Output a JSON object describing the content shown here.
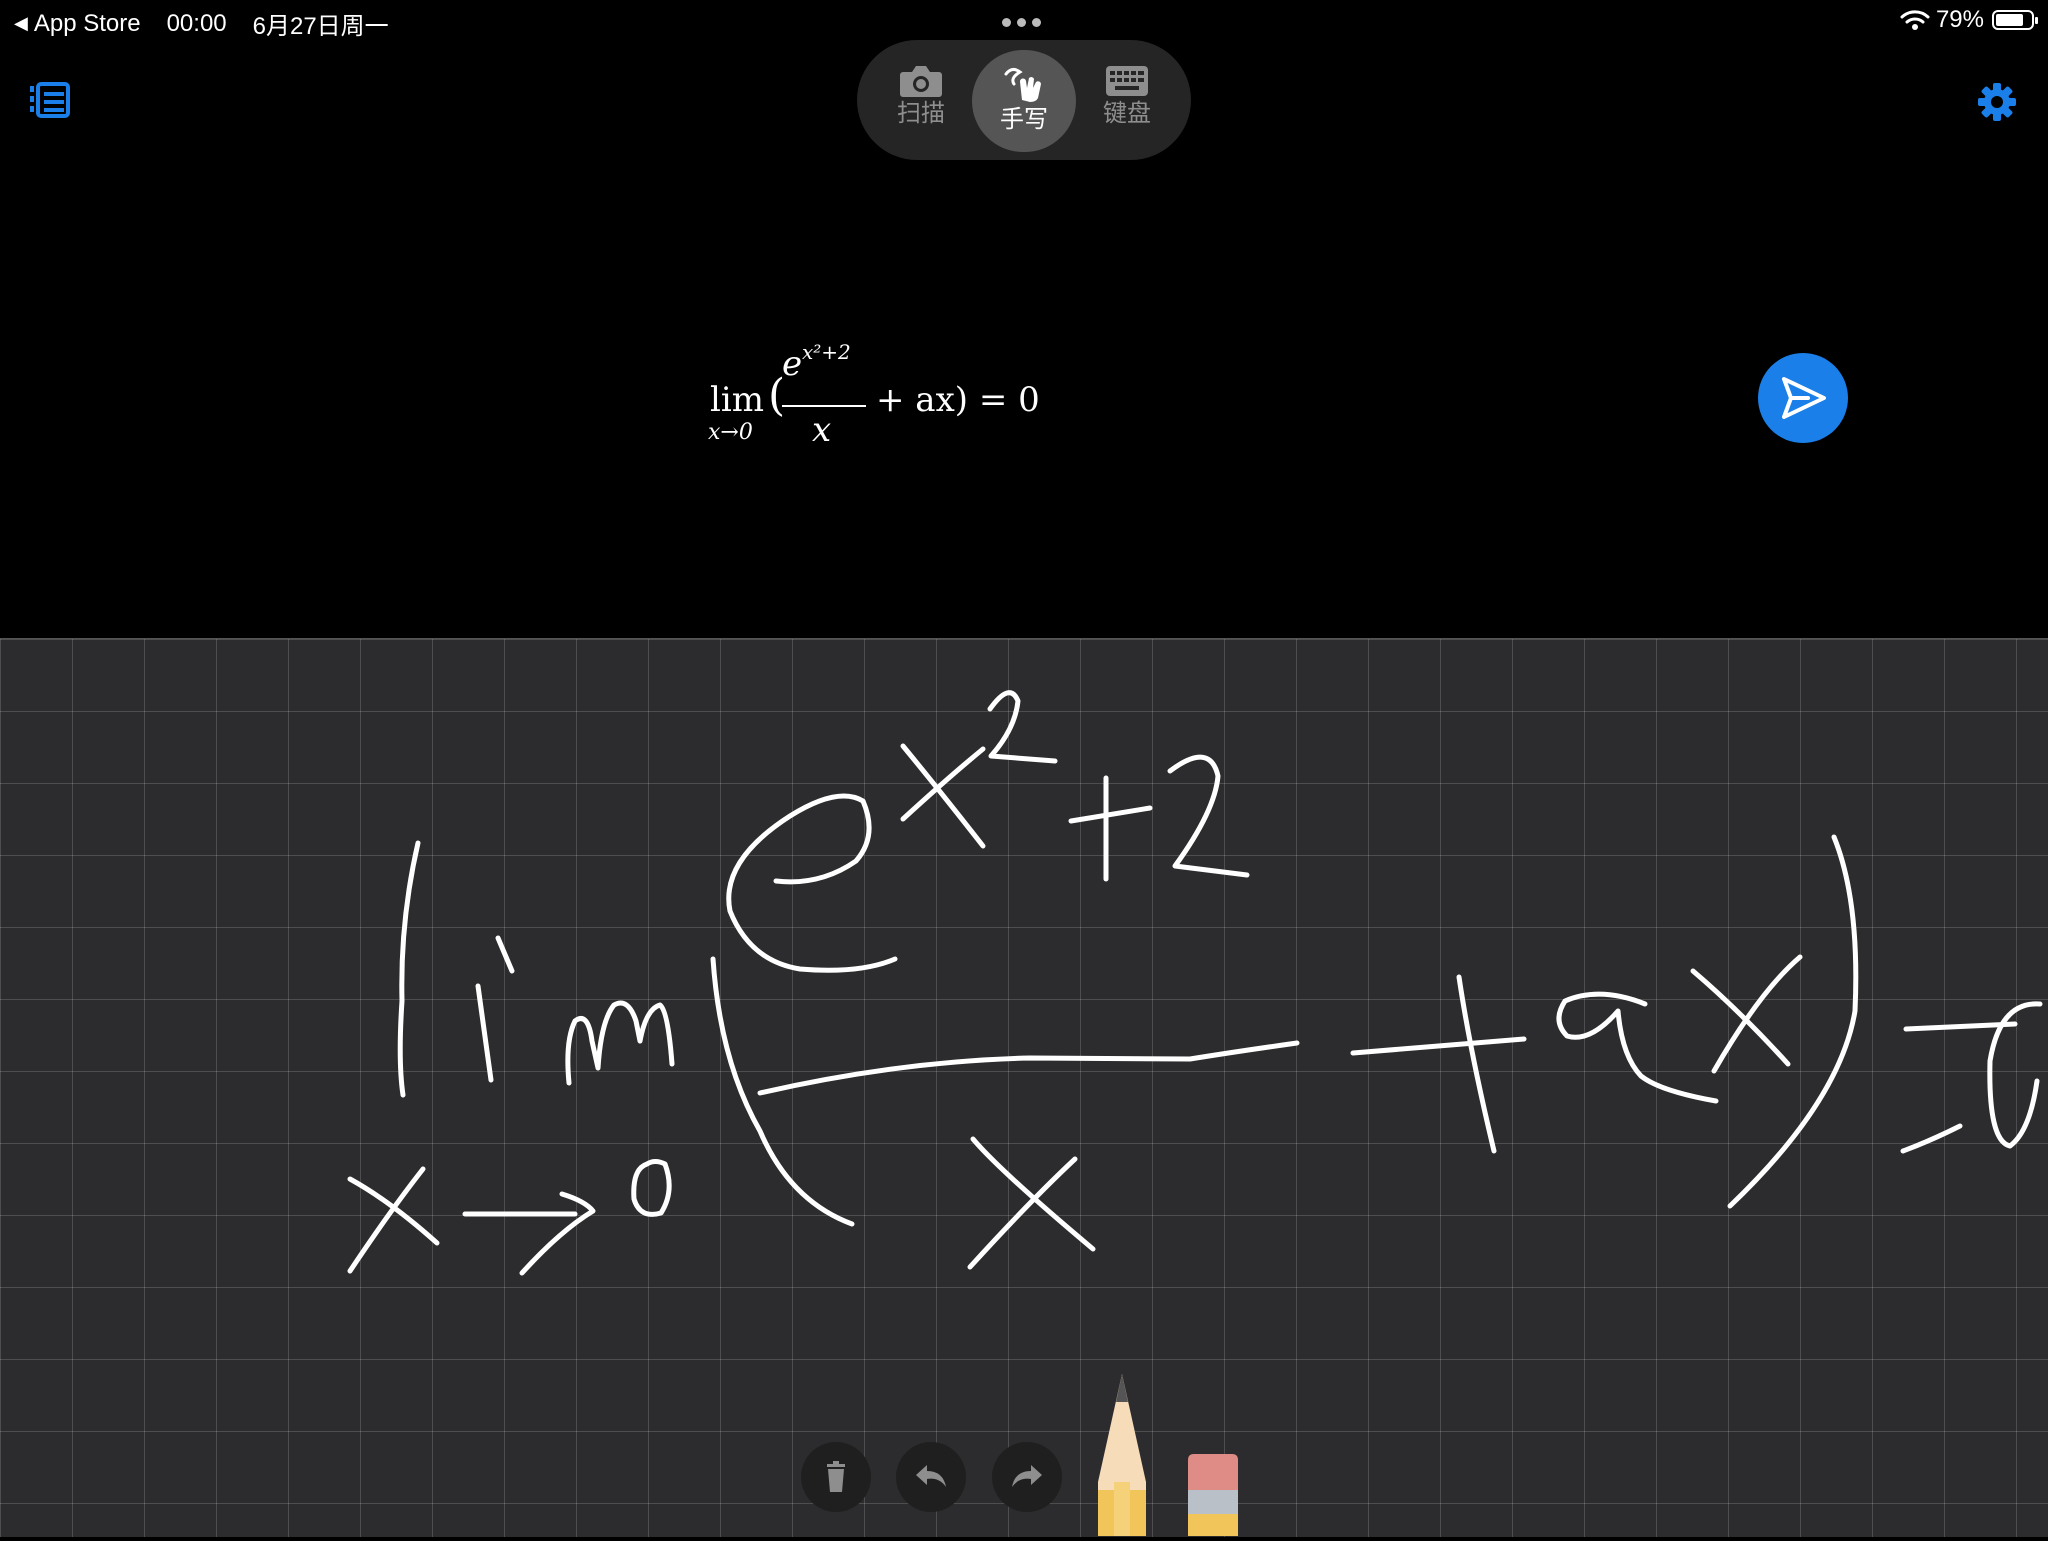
{
  "status_bar": {
    "back_app": "App Store",
    "time": "00:00",
    "date": "6月27日周一",
    "battery": "79%",
    "battery_level": 0.79
  },
  "modes": [
    {
      "label": "扫描",
      "icon": "camera-icon",
      "active": false
    },
    {
      "label": "手写",
      "icon": "hand-draw-icon",
      "active": true
    },
    {
      "label": "键盘",
      "icon": "keyboard-icon",
      "active": false
    }
  ],
  "formula": {
    "lim": "lim",
    "subscript": "x→0",
    "open_paren": "(",
    "numerator": "e",
    "exponent": "x²+2",
    "denominator": "x",
    "rest": "+ ax) = 0"
  },
  "icons": {
    "list": "list-icon",
    "settings": "gear-icon",
    "send": "send-icon",
    "trash": "trash-icon",
    "undo": "undo-icon",
    "redo": "redo-icon",
    "pencil": "pencil-icon",
    "eraser": "eraser-icon"
  },
  "colors": {
    "accent": "#1a7fe8",
    "canvas": "#2c2c2e",
    "ink": "#ffffff"
  }
}
